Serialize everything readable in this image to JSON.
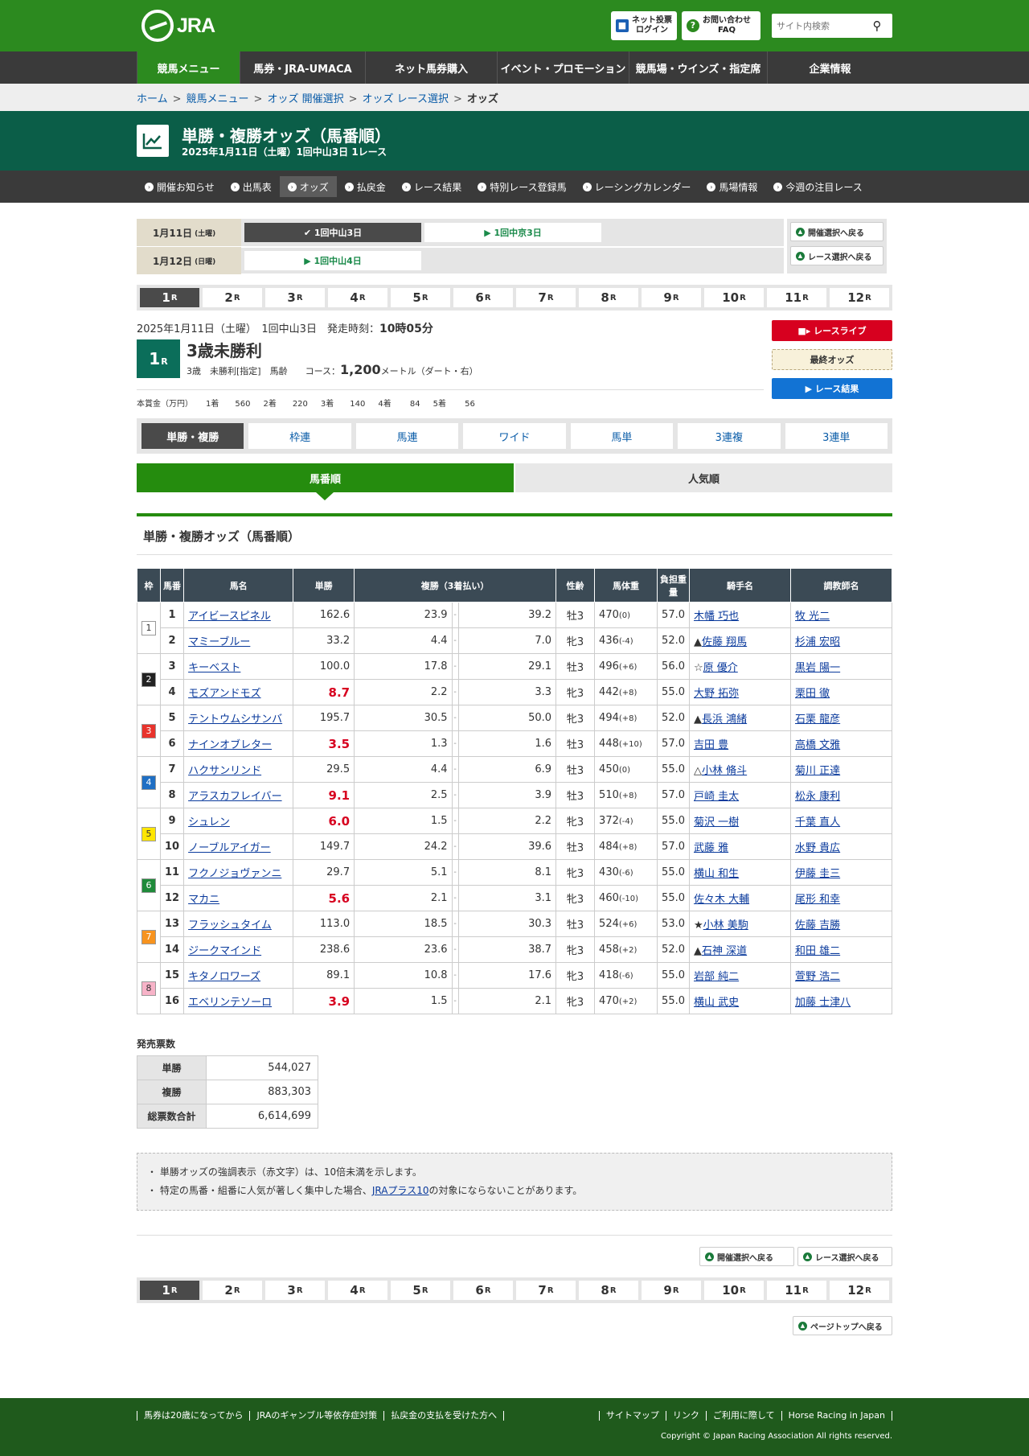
{
  "header": {
    "logo": "JRA",
    "login_l1": "ネット投票",
    "login_l2": "ログイン",
    "faq_l1": "お問い合わせ",
    "faq_l2": "FAQ",
    "search_placeholder": "サイト内検索"
  },
  "gnav": [
    "競馬メニュー",
    "馬券・JRA-UMACA",
    "ネット馬券購入",
    "イベント・プロモーション",
    "競馬場・ウインズ・指定席",
    "企業情報"
  ],
  "breadcrumb": [
    "ホーム",
    "競馬メニュー",
    "オッズ 開催選択",
    "オッズ レース選択",
    "オッズ"
  ],
  "title": {
    "main": "単勝・複勝オッズ（馬番順）",
    "sub": "2025年1月11日（土曜）1回中山3日 1レース"
  },
  "subnav": [
    "開催お知らせ",
    "出馬表",
    "オッズ",
    "払戻金",
    "レース結果",
    "特別レース登録馬",
    "レーシングカレンダー",
    "馬場情報",
    "今週の注目レース"
  ],
  "kaisai": {
    "day1": {
      "date": "1月11日",
      "dow": "(土曜)",
      "btn1": "1回中山3日",
      "btn2": "1回中京3日"
    },
    "day2": {
      "date": "1月12日",
      "dow": "(日曜)",
      "btn1": "1回中山4日"
    },
    "back_kaisai": "開催選択へ戻る",
    "back_race": "レース選択へ戻る"
  },
  "races": [
    "1",
    "2",
    "3",
    "4",
    "5",
    "6",
    "7",
    "8",
    "9",
    "10",
    "11",
    "12"
  ],
  "race_suffix": "R",
  "race": {
    "dateline": "2025年1月11日（土曜）　1回中山3日　発走時刻：",
    "time": "10時05分",
    "num": "1",
    "name": "3歳未勝利",
    "cond": "3歳　未勝利[指定]　馬齢　　コース：",
    "dist": "1,200",
    "dist_unit": "メートル（ダート・右）",
    "prize": [
      "本賞金（万円）",
      "1着　　560",
      "2着　　220",
      "3着　　140",
      "4着　　 84",
      "5着　　 56"
    ],
    "live": "レースライブ",
    "final": "最終オッズ",
    "result": "レース結果"
  },
  "odds_tabs": [
    "単勝・複勝",
    "枠連",
    "馬連",
    "ワイド",
    "馬単",
    "3連複",
    "3連単"
  ],
  "sort_tabs": [
    "馬番順",
    "人気順"
  ],
  "section_title": "単勝・複勝オッズ（馬番順）",
  "table_headers": [
    "枠",
    "馬番",
    "馬名",
    "単勝",
    "複勝（3着払い）",
    "性齢",
    "馬体重",
    "負担重量",
    "騎手名",
    "調教師名"
  ],
  "rows": [
    {
      "waku": "1",
      "num": "1",
      "name": "アイビースピネル",
      "win": "162.6",
      "pmin": "23.9",
      "pmax": "39.2",
      "sa": "牡3",
      "wt": "470",
      "dif": "(0)",
      "load": "57.0",
      "jockey": "木幡 巧也",
      "trainer": "牧 光二"
    },
    {
      "waku": "",
      "num": "2",
      "name": "マミーブルー",
      "win": "33.2",
      "pmin": "4.4",
      "pmax": "7.0",
      "sa": "牝3",
      "wt": "436",
      "dif": "(-4)",
      "load": "52.0",
      "jockey": "▲佐藤 翔馬",
      "trainer": "杉浦 宏昭"
    },
    {
      "waku": "2",
      "num": "3",
      "name": "キーベスト",
      "win": "100.0",
      "pmin": "17.8",
      "pmax": "29.1",
      "sa": "牡3",
      "wt": "496",
      "dif": "(+6)",
      "load": "56.0",
      "jockey": "☆原 優介",
      "trainer": "黒岩 陽一"
    },
    {
      "waku": "",
      "num": "4",
      "name": "モズアンドモズ",
      "win": "8.7",
      "pmin": "2.2",
      "pmax": "3.3",
      "sa": "牝3",
      "wt": "442",
      "dif": "(+8)",
      "load": "55.0",
      "jockey": "大野 拓弥",
      "trainer": "栗田 徹"
    },
    {
      "waku": "3",
      "num": "5",
      "name": "テントウムシサンバ",
      "win": "195.7",
      "pmin": "30.5",
      "pmax": "50.0",
      "sa": "牝3",
      "wt": "494",
      "dif": "(+8)",
      "load": "52.0",
      "jockey": "▲長浜 鴻緒",
      "trainer": "石栗 龍彦"
    },
    {
      "waku": "",
      "num": "6",
      "name": "ナインオブレター",
      "win": "3.5",
      "pmin": "1.3",
      "pmax": "1.6",
      "sa": "牡3",
      "wt": "448",
      "dif": "(+10)",
      "load": "57.0",
      "jockey": "吉田 豊",
      "trainer": "高橋 文雅"
    },
    {
      "waku": "4",
      "num": "7",
      "name": "ハクサンリンド",
      "win": "29.5",
      "pmin": "4.4",
      "pmax": "6.9",
      "sa": "牡3",
      "wt": "450",
      "dif": "(0)",
      "load": "55.0",
      "jockey": "△小林 脩斗",
      "trainer": "菊川 正達"
    },
    {
      "waku": "",
      "num": "8",
      "name": "アラスカフレイバー",
      "win": "9.1",
      "pmin": "2.5",
      "pmax": "3.9",
      "sa": "牡3",
      "wt": "510",
      "dif": "(+8)",
      "load": "57.0",
      "jockey": "戸崎 圭太",
      "trainer": "松永 康利"
    },
    {
      "waku": "5",
      "num": "9",
      "name": "シュレン",
      "win": "6.0",
      "pmin": "1.5",
      "pmax": "2.2",
      "sa": "牝3",
      "wt": "372",
      "dif": "(-4)",
      "load": "55.0",
      "jockey": "菊沢 一樹",
      "trainer": "千葉 直人"
    },
    {
      "waku": "",
      "num": "10",
      "name": "ノーブルアイガー",
      "win": "149.7",
      "pmin": "24.2",
      "pmax": "39.6",
      "sa": "牡3",
      "wt": "484",
      "dif": "(+8)",
      "load": "57.0",
      "jockey": "武藤 雅",
      "trainer": "水野 貴広"
    },
    {
      "waku": "6",
      "num": "11",
      "name": "フクノジョヴァンニ",
      "win": "29.7",
      "pmin": "5.1",
      "pmax": "8.1",
      "sa": "牝3",
      "wt": "430",
      "dif": "(-6)",
      "load": "55.0",
      "jockey": "横山 和生",
      "trainer": "伊藤 圭三"
    },
    {
      "waku": "",
      "num": "12",
      "name": "マカニ",
      "win": "5.6",
      "pmin": "2.1",
      "pmax": "3.1",
      "sa": "牝3",
      "wt": "460",
      "dif": "(-10)",
      "load": "55.0",
      "jockey": "佐々木 大輔",
      "trainer": "尾形 和幸"
    },
    {
      "waku": "7",
      "num": "13",
      "name": "フラッシュタイム",
      "win": "113.0",
      "pmin": "18.5",
      "pmax": "30.3",
      "sa": "牡3",
      "wt": "524",
      "dif": "(+6)",
      "load": "53.0",
      "jockey": "★小林 美駒",
      "trainer": "佐藤 吉勝"
    },
    {
      "waku": "",
      "num": "14",
      "name": "ジークマインド",
      "win": "238.6",
      "pmin": "23.6",
      "pmax": "38.7",
      "sa": "牝3",
      "wt": "458",
      "dif": "(+2)",
      "load": "52.0",
      "jockey": "▲石神 深道",
      "trainer": "和田 雄二"
    },
    {
      "waku": "8",
      "num": "15",
      "name": "キタノロワーズ",
      "win": "89.1",
      "pmin": "10.8",
      "pmax": "17.6",
      "sa": "牝3",
      "wt": "418",
      "dif": "(-6)",
      "load": "55.0",
      "jockey": "岩部 純二",
      "trainer": "萱野 浩二"
    },
    {
      "waku": "",
      "num": "16",
      "name": "エベリンテソーロ",
      "win": "3.9",
      "pmin": "1.5",
      "pmax": "2.1",
      "sa": "牝3",
      "wt": "470",
      "dif": "(+2)",
      "load": "55.0",
      "jockey": "横山 武史",
      "trainer": "加藤 士津八"
    }
  ],
  "waku_colors": {
    "1": "#ffffff",
    "2": "#222222",
    "3": "#e8332c",
    "4": "#1f6fc4",
    "5": "#ffe600",
    "6": "#1f8a3a",
    "7": "#f7931e",
    "8": "#f7b3c8"
  },
  "sales": {
    "label": "発売票数",
    "rows": [
      {
        "k": "単勝",
        "v": "544,027"
      },
      {
        "k": "複勝",
        "v": "883,303"
      },
      {
        "k": "総票数合計",
        "v": "6,614,699"
      }
    ]
  },
  "notes": {
    "n1": "・ 単勝オッズの強調表示（赤文字）は、10倍未満を示します。",
    "n2a": "・ 特定の馬番・組番に人気が著しく集中した場合、",
    "n2link": "JRAプラス10",
    "n2b": "の対象にならないことがあります。"
  },
  "page_top": "ページトップへ戻る",
  "footer": {
    "left": [
      "馬券は20歳になってから",
      "JRAのギャンブル等依存症対策",
      "払戻金の支払を受けた方へ"
    ],
    "right": [
      "サイトマップ",
      "リンク",
      "ご利用に際して",
      "Horse Racing in Japan"
    ],
    "copy": "Copyright © Japan Racing Association All rights reserved."
  }
}
